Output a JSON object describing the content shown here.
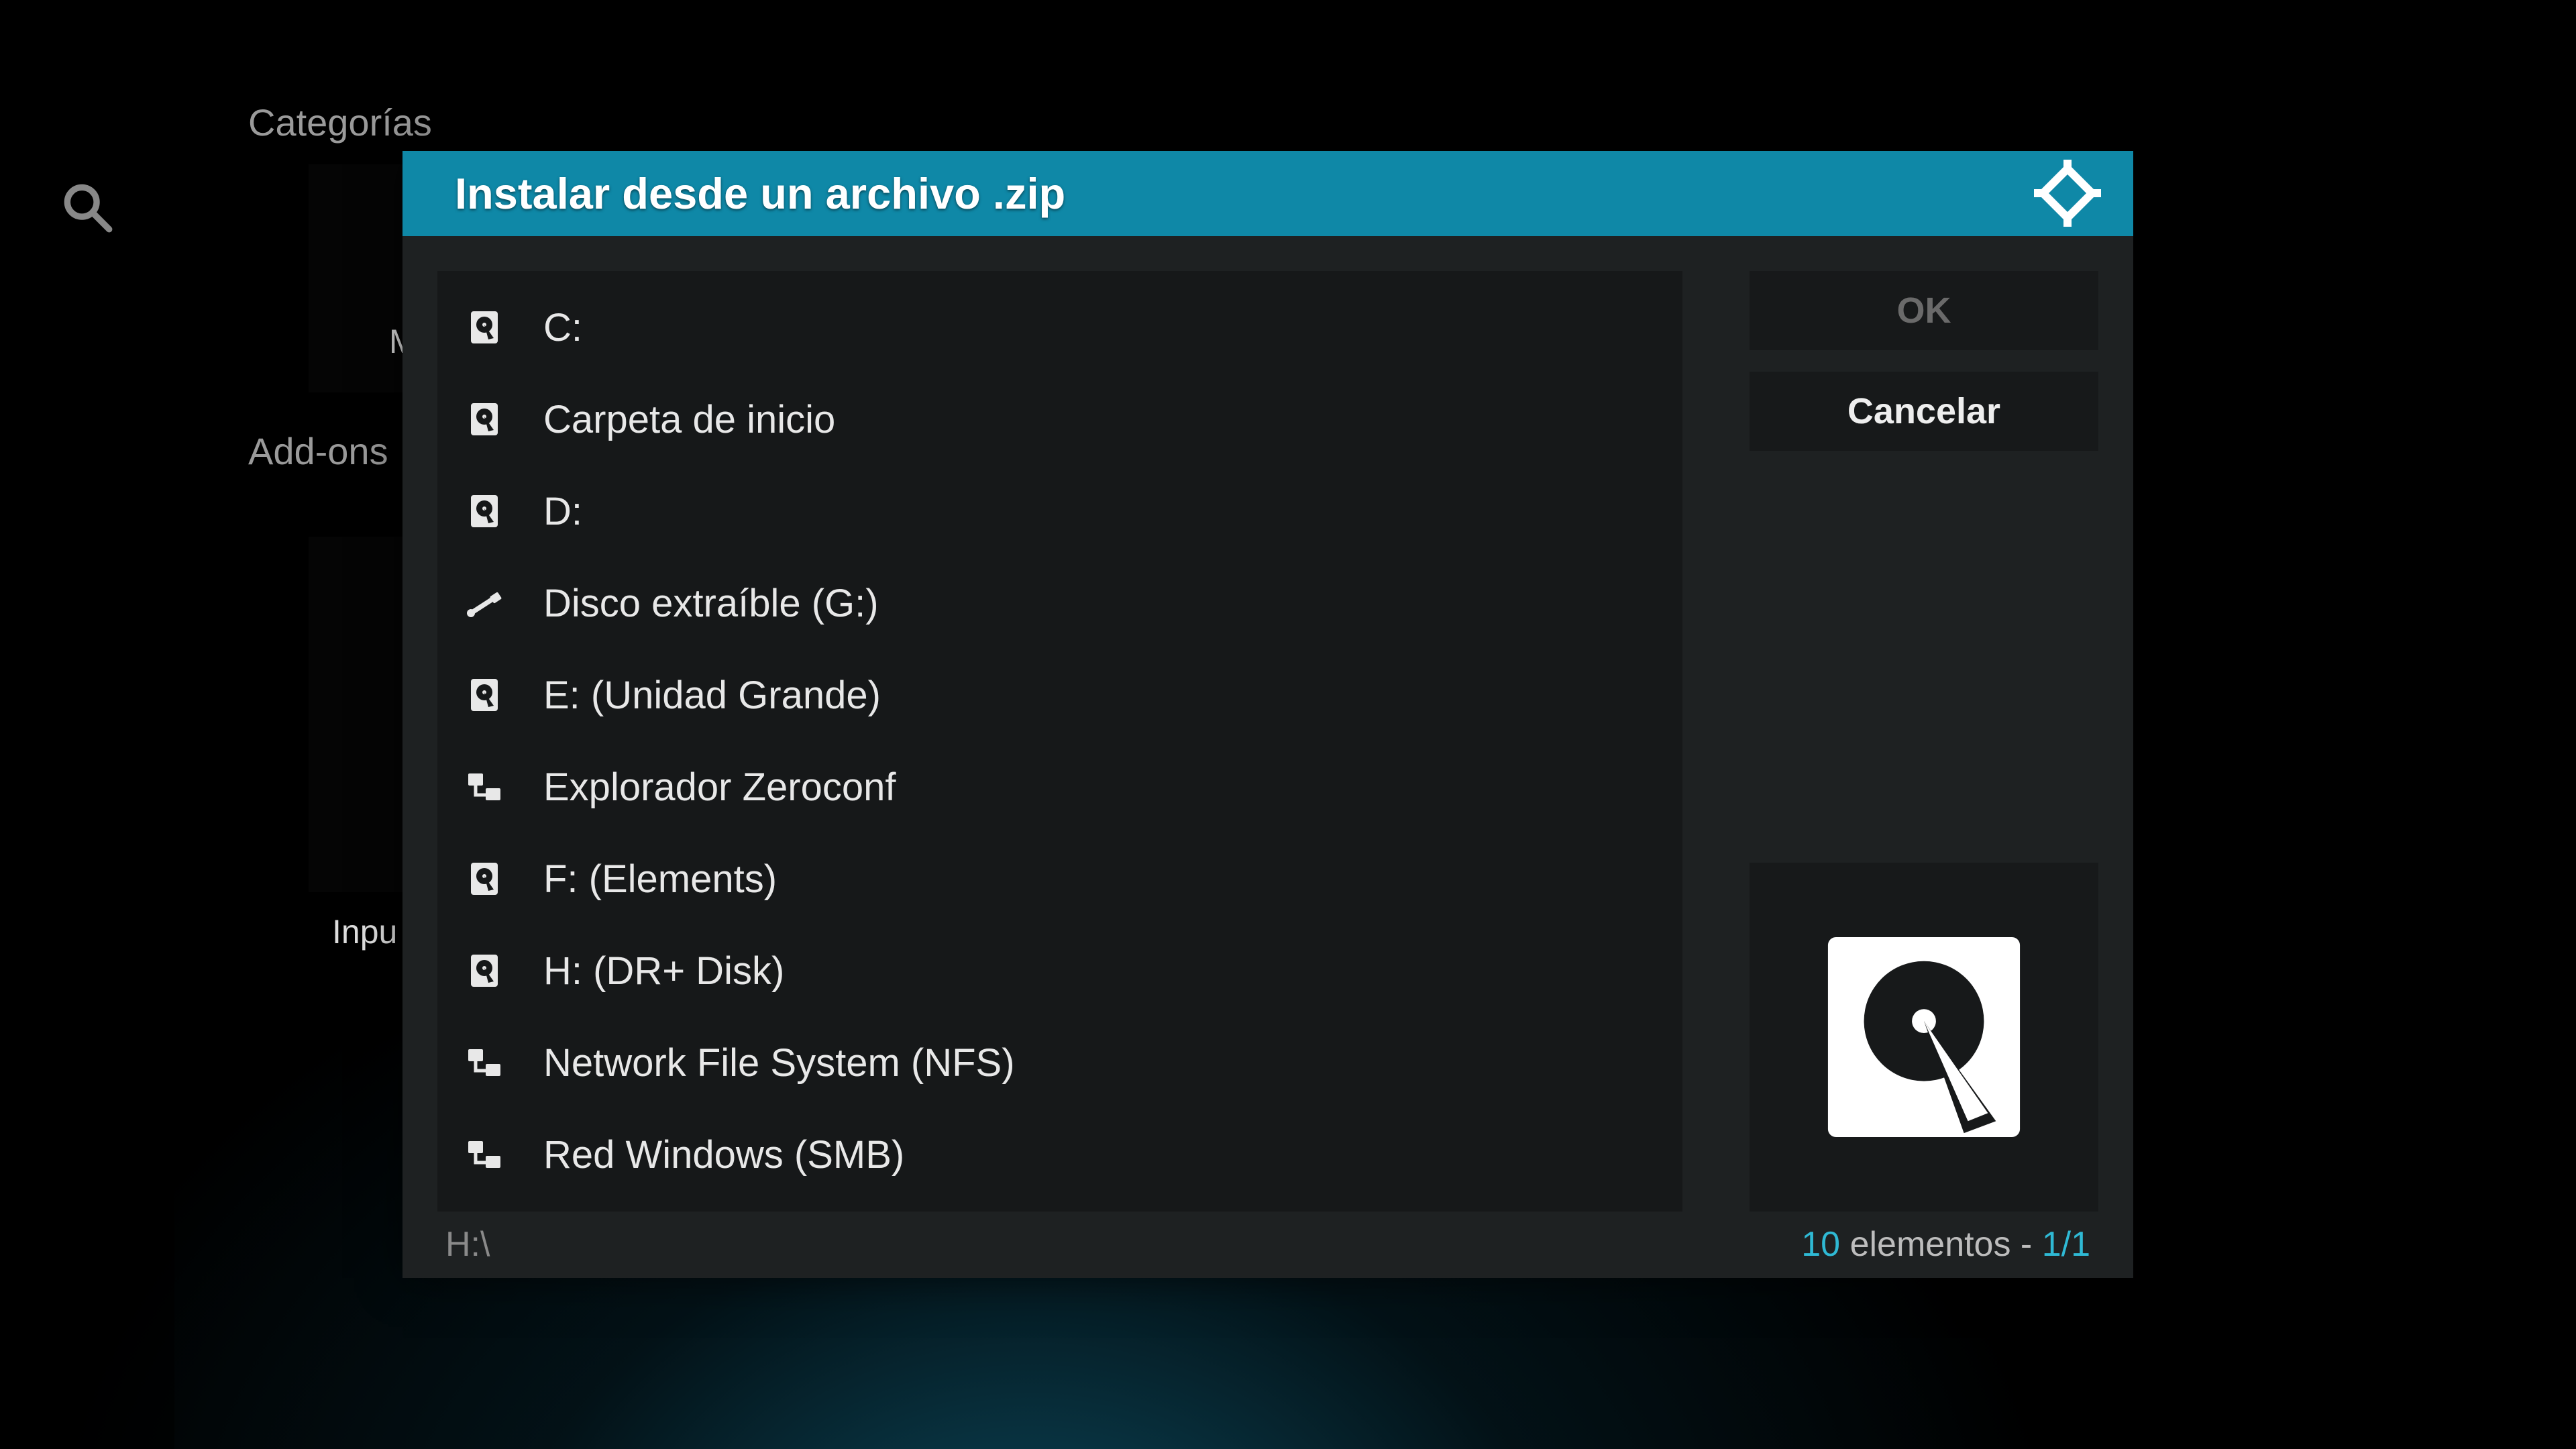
{
  "background": {
    "categories_label": "Categorías",
    "addons_label": "Add-ons",
    "tile1_caption": "M",
    "tile2_caption": "Inpu"
  },
  "dialog": {
    "title": "Instalar desde un archivo .zip",
    "items": [
      {
        "label": "C:",
        "icon": "hdd"
      },
      {
        "label": "Carpeta de inicio",
        "icon": "hdd"
      },
      {
        "label": "D:",
        "icon": "hdd"
      },
      {
        "label": "Disco extraíble (G:)",
        "icon": "usb"
      },
      {
        "label": "E: (Unidad Grande)",
        "icon": "hdd"
      },
      {
        "label": "Explorador Zeroconf",
        "icon": "network"
      },
      {
        "label": "F: (Elements)",
        "icon": "hdd"
      },
      {
        "label": "H: (DR+ Disk)",
        "icon": "hdd"
      },
      {
        "label": "Network File System (NFS)",
        "icon": "network"
      },
      {
        "label": "Red Windows (SMB)",
        "icon": "network"
      }
    ],
    "ok_label": "OK",
    "cancel_label": "Cancelar",
    "current_path": "H:\\",
    "footer": {
      "count": "10",
      "count_word": "elementos",
      "separator": " - ",
      "page": "1/1"
    }
  }
}
